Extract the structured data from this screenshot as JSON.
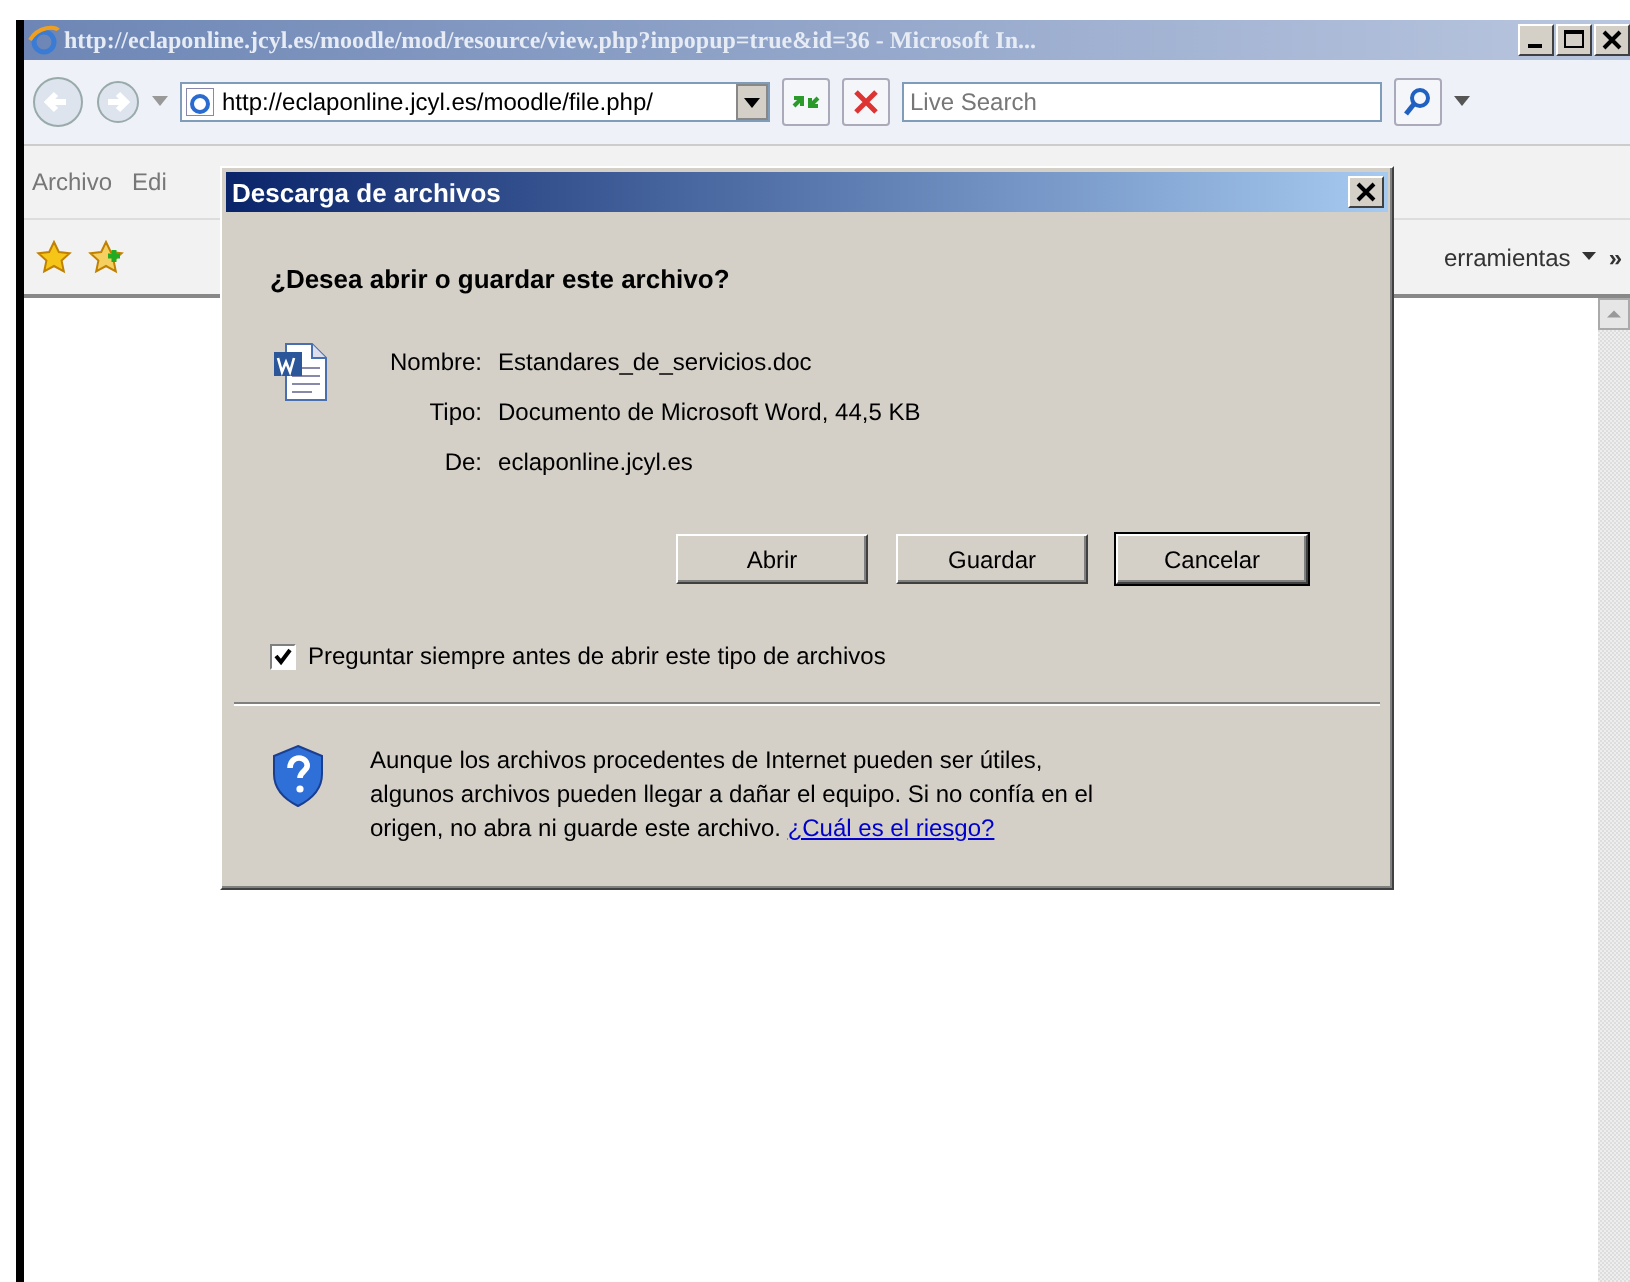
{
  "window": {
    "title": "http://eclaponline.jcyl.es/moodle/mod/resource/view.php?inpopup=true&id=36 - Microsoft In..."
  },
  "nav": {
    "address": "http://eclaponline.jcyl.es/moodle/file.php/",
    "search_placeholder": "Live Search"
  },
  "menu": [
    "Archivo",
    "Edi"
  ],
  "favorites_bar": {
    "tools_menu": "erramientas",
    "more": "»"
  },
  "dialog": {
    "title": "Descarga de archivos",
    "question": "¿Desea abrir o guardar este archivo?",
    "file": [
      {
        "label": "Nombre:",
        "value": "Estandares_de_servicios.doc"
      },
      {
        "label": "Tipo:",
        "value": "Documento de Microsoft Word, 44,5 KB"
      },
      {
        "label": "De:",
        "value": "eclaponline.jcyl.es"
      }
    ],
    "buttons": [
      {
        "label": "Abrir",
        "default": false
      },
      {
        "label": "Guardar",
        "default": false
      },
      {
        "label": "Cancelar",
        "default": true
      }
    ],
    "checkbox": {
      "label": "Preguntar siempre antes de abrir este tipo de archivos",
      "checked": true
    },
    "warning": {
      "text": "Aunque los archivos procedentes de Internet pueden ser útiles, algunos archivos pueden llegar a dañar el equipo. Si no confía en el origen, no abra ni guarde este archivo.",
      "link": "¿Cuál es el riesgo?"
    }
  }
}
